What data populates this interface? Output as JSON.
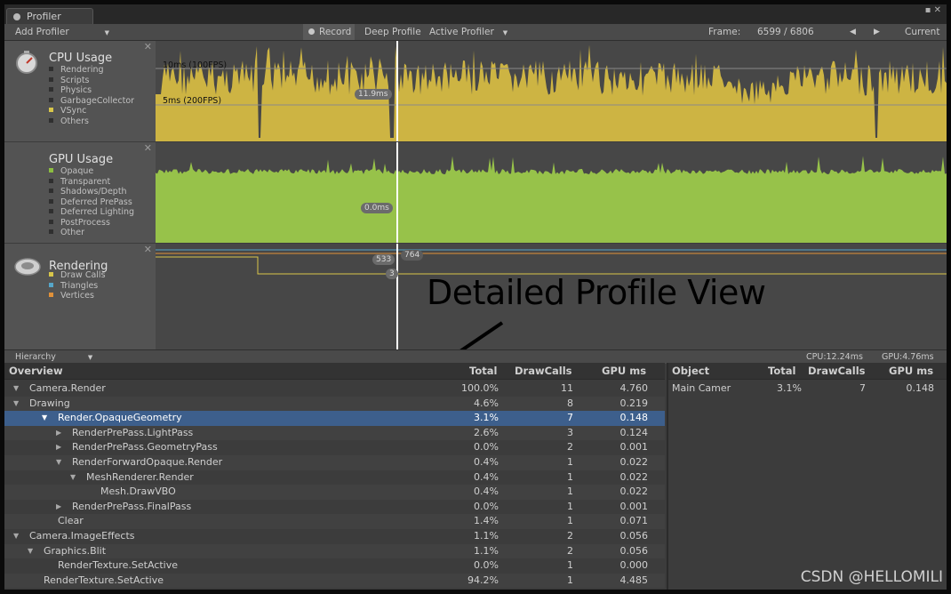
{
  "window": {
    "title": "Profiler",
    "controls": "▪ ✕"
  },
  "toolbar": {
    "add_profiler": "Add Profiler",
    "record": "Record",
    "deep_profile": "Deep Profile",
    "active_profiler": "Active Profiler",
    "frame_label": "Frame:",
    "frame_value": "6599 / 6806",
    "prev_icon": "◀",
    "next_icon": "▶",
    "current": "Current"
  },
  "cpu": {
    "title": "CPU Usage",
    "items": [
      {
        "label": "Rendering",
        "color": "#2f2f2f"
      },
      {
        "label": "Scripts",
        "color": "#2f2f2f"
      },
      {
        "label": "Physics",
        "color": "#2f2f2f"
      },
      {
        "label": "GarbageCollector",
        "color": "#2f2f2f"
      },
      {
        "label": "VSync",
        "color": "#d8c64a"
      },
      {
        "label": "Others",
        "color": "#2f2f2f"
      }
    ],
    "line_10ms": "10ms (100FPS)",
    "line_5ms": "5ms (200FPS)",
    "cursor_value": "11.9ms",
    "fill_color": "#cdb443"
  },
  "gpu": {
    "title": "GPU Usage",
    "items": [
      {
        "label": "Opaque",
        "color": "#8cbd40"
      },
      {
        "label": "Transparent",
        "color": "#2f2f2f"
      },
      {
        "label": "Shadows/Depth",
        "color": "#2f2f2f"
      },
      {
        "label": "Deferred PrePass",
        "color": "#2f2f2f"
      },
      {
        "label": "Deferred Lighting",
        "color": "#2f2f2f"
      },
      {
        "label": "PostProcess",
        "color": "#2f2f2f"
      },
      {
        "label": "Other",
        "color": "#2f2f2f"
      }
    ],
    "cursor_value": "0.0ms",
    "fill_color": "#97c24a"
  },
  "rendering": {
    "title": "Rendering",
    "items": [
      {
        "label": "Draw Calls",
        "color": "#d8c64a"
      },
      {
        "label": "Triangles",
        "color": "#56a6c9"
      },
      {
        "label": "Vertices",
        "color": "#e0913a"
      }
    ],
    "val_a": "533",
    "val_b": "764",
    "val_c": "3"
  },
  "annotation": "Detailed Profile View",
  "hierarchy_bar": {
    "mode": "Hierarchy",
    "cpu": "CPU:12.24ms",
    "gpu": "GPU:4.76ms"
  },
  "left_table": {
    "headers": {
      "name": "Overview",
      "total": "Total",
      "drawcalls": "DrawCalls",
      "gpu": "GPU ms"
    },
    "rows": [
      {
        "name": "Camera.Render",
        "total": "100.0%",
        "dc": "11",
        "gpu": "4.760"
      },
      {
        "name": "Drawing",
        "total": "4.6%",
        "dc": "8",
        "gpu": "0.219"
      },
      {
        "name": "Render.OpaqueGeometry",
        "total": "3.1%",
        "dc": "7",
        "gpu": "0.148"
      },
      {
        "name": "RenderPrePass.LightPass",
        "total": "2.6%",
        "dc": "3",
        "gpu": "0.124"
      },
      {
        "name": "RenderPrePass.GeometryPass",
        "total": "0.0%",
        "dc": "2",
        "gpu": "0.001"
      },
      {
        "name": "RenderForwardOpaque.Render",
        "total": "0.4%",
        "dc": "1",
        "gpu": "0.022"
      },
      {
        "name": "MeshRenderer.Render",
        "total": "0.4%",
        "dc": "1",
        "gpu": "0.022"
      },
      {
        "name": "Mesh.DrawVBO",
        "total": "0.4%",
        "dc": "1",
        "gpu": "0.022"
      },
      {
        "name": "RenderPrePass.FinalPass",
        "total": "0.0%",
        "dc": "1",
        "gpu": "0.001"
      },
      {
        "name": "Clear",
        "total": "1.4%",
        "dc": "1",
        "gpu": "0.071"
      },
      {
        "name": "Camera.ImageEffects",
        "total": "1.1%",
        "dc": "2",
        "gpu": "0.056"
      },
      {
        "name": "Graphics.Blit",
        "total": "1.1%",
        "dc": "2",
        "gpu": "0.056"
      },
      {
        "name": "RenderTexture.SetActive",
        "total": "0.0%",
        "dc": "1",
        "gpu": "0.000"
      },
      {
        "name": "RenderTexture.SetActive",
        "total": "94.2%",
        "dc": "1",
        "gpu": "4.485"
      }
    ]
  },
  "right_table": {
    "headers": {
      "name": "Object",
      "total": "Total",
      "drawcalls": "DrawCalls",
      "gpu": "GPU ms"
    },
    "rows": [
      {
        "name": "Main Camer",
        "total": "3.1%",
        "dc": "7",
        "gpu": "0.148"
      }
    ]
  },
  "watermark": "CSDN @HELLOMILI"
}
